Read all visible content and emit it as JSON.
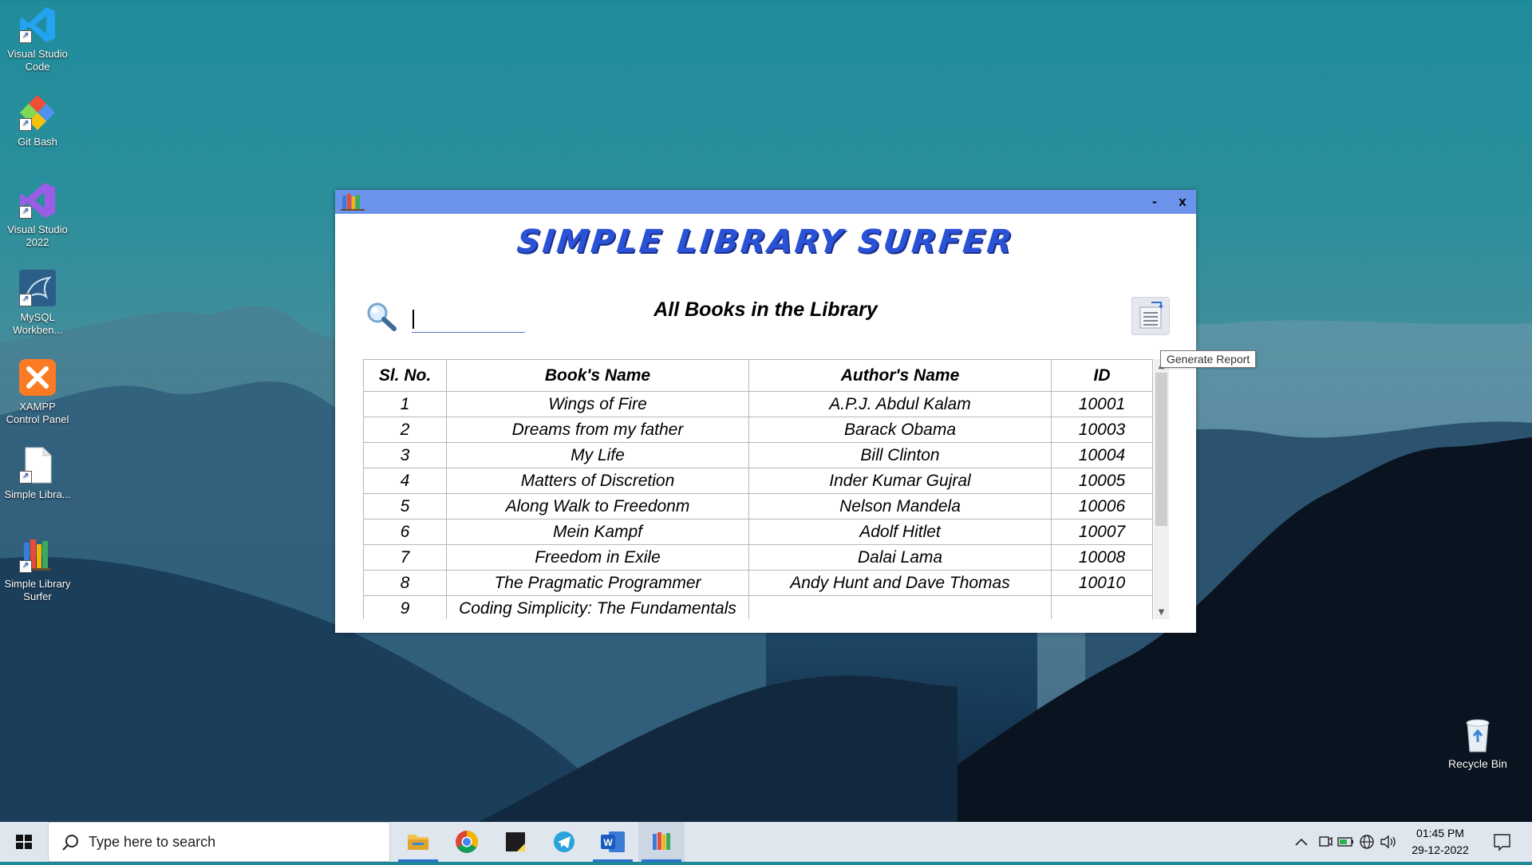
{
  "desktop": {
    "icons": [
      {
        "label": "Visual Studio Code",
        "icon": "vscode-icon"
      },
      {
        "label": "Git Bash",
        "icon": "git-bash-icon"
      },
      {
        "label": "Visual Studio 2022",
        "icon": "visual-studio-icon"
      },
      {
        "label": "MySQL Workben...",
        "icon": "mysql-workbench-icon"
      },
      {
        "label": "XAMPP Control Panel",
        "icon": "xampp-icon"
      },
      {
        "label": "Simple Libra...",
        "icon": "file-icon"
      },
      {
        "label": "Simple Library Surfer",
        "icon": "books-icon"
      }
    ],
    "recycle_bin": {
      "label": "Recycle Bin",
      "icon": "recycle-bin-icon"
    }
  },
  "window": {
    "minimize_label": "-",
    "close_label": "x",
    "brand_title": "SIMPLE LIBRARY SURFER",
    "section_title": "All Books in the Library",
    "search": {
      "value": "",
      "placeholder": ""
    },
    "report_tooltip": "Generate Report",
    "colors": {
      "titlebar": "#6b93ec",
      "brand": "#2a52d6"
    }
  },
  "table": {
    "columns": [
      "Sl. No.",
      "Book's Name",
      "Author's Name",
      "ID"
    ],
    "rows": [
      [
        "1",
        "Wings of Fire",
        "A.P.J. Abdul Kalam",
        "10001"
      ],
      [
        "2",
        "Dreams from my father",
        "Barack Obama",
        "10003"
      ],
      [
        "3",
        "My Life",
        "Bill Clinton",
        "10004"
      ],
      [
        "4",
        "Matters of Discretion",
        "Inder Kumar Gujral",
        "10005"
      ],
      [
        "5",
        "Along Walk to Freedonm",
        "Nelson Mandela",
        "10006"
      ],
      [
        "6",
        "Mein Kampf",
        "Adolf Hitlet",
        "10007"
      ],
      [
        "7",
        "Freedom in Exile",
        "Dalai Lama",
        "10008"
      ],
      [
        "8",
        "The Pragmatic Programmer",
        "Andy Hunt and Dave Thomas",
        "10010"
      ],
      [
        "9",
        "Coding Simplicity: The Fundamentals",
        "",
        ""
      ]
    ]
  },
  "taskbar": {
    "search_placeholder": "Type here to search",
    "apps": [
      "file-explorer-icon",
      "chrome-icon",
      "sticky-notes-icon",
      "telegram-icon",
      "word-icon",
      "library-app-icon"
    ],
    "clock": {
      "time": "01:45 PM",
      "date": "29-12-2022"
    }
  }
}
